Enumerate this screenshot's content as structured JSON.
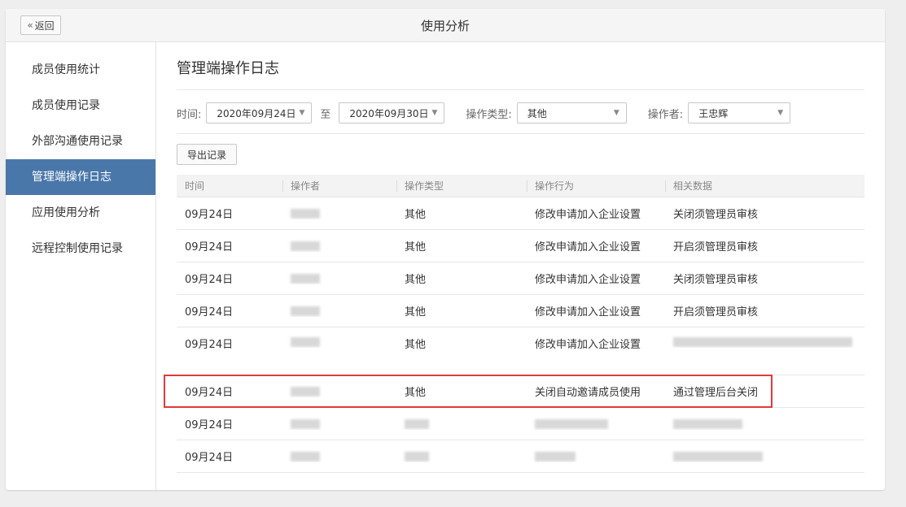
{
  "header": {
    "back_label": "返回",
    "back_icon": "double-chevron-left-icon",
    "title": "使用分析"
  },
  "sidebar": {
    "items": [
      {
        "label": "成员使用统计",
        "active": false
      },
      {
        "label": "成员使用记录",
        "active": false
      },
      {
        "label": "外部沟通使用记录",
        "active": false
      },
      {
        "label": "管理端操作日志",
        "active": true
      },
      {
        "label": "应用使用分析",
        "active": false
      },
      {
        "label": "远程控制使用记录",
        "active": false
      }
    ]
  },
  "main": {
    "title": "管理端操作日志",
    "filters": {
      "time_label": "时间:",
      "date_start": "2020年09月24日",
      "to_label": "至",
      "date_end": "2020年09月30日",
      "type_label": "操作类型:",
      "type_value": "其他",
      "operator_label": "操作者:",
      "operator_value": "王忠辉"
    },
    "export_label": "导出记录",
    "table": {
      "headers": [
        "时间",
        "操作者",
        "操作类型",
        "操作行为",
        "相关数据"
      ],
      "rows": [
        {
          "time": "09月24日",
          "type": "其他",
          "action": "修改申请加入企业设置",
          "data": "关闭须管理员审核"
        },
        {
          "time": "09月24日",
          "type": "其他",
          "action": "修改申请加入企业设置",
          "data": "开启须管理员审核"
        },
        {
          "time": "09月24日",
          "type": "其他",
          "action": "修改申请加入企业设置",
          "data": "关闭须管理员审核"
        },
        {
          "time": "09月24日",
          "type": "其他",
          "action": "修改申请加入企业设置",
          "data": "开启须管理员审核"
        },
        {
          "time": "09月24日",
          "type": "其他",
          "action": "修改申请加入企业设置",
          "data": ""
        },
        {
          "time": "09月24日",
          "type": "其他",
          "action": "关闭自动邀请成员使用",
          "data": "通过管理后台关闭"
        },
        {
          "time": "09月24日",
          "type": "",
          "action": "",
          "data": ""
        },
        {
          "time": "09月24日",
          "type": "",
          "action": "",
          "data": ""
        }
      ]
    }
  },
  "colors": {
    "accent": "#4a77aa",
    "highlight": "#e03a3a"
  }
}
